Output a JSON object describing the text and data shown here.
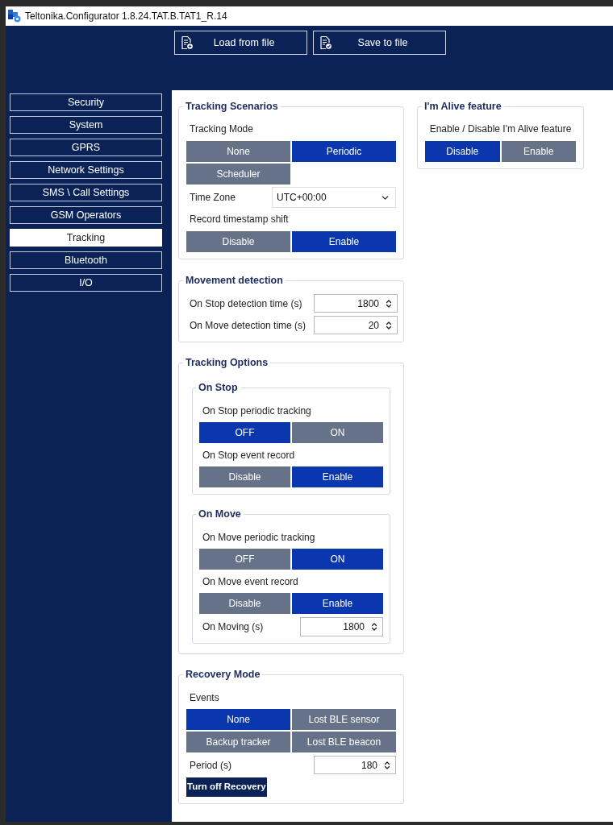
{
  "window": {
    "title": "Teltonika.Configurator 1.8.24.TAT.B.TAT1_R.14"
  },
  "toolbar": {
    "buttons": [
      {
        "kind": "load",
        "label": "Load from file"
      },
      {
        "kind": "save",
        "label": "Save to file"
      }
    ]
  },
  "sidebar": {
    "items": [
      {
        "label": "Security",
        "selected": false
      },
      {
        "label": "System",
        "selected": false
      },
      {
        "label": "GPRS",
        "selected": false
      },
      {
        "label": "Network Settings",
        "selected": false
      },
      {
        "label": "SMS \\ Call Settings",
        "selected": false
      },
      {
        "label": "GSM Operators",
        "selected": false
      },
      {
        "label": "Tracking",
        "selected": true
      },
      {
        "label": "Bluetooth",
        "selected": false
      },
      {
        "label": "I/O",
        "selected": false
      }
    ]
  },
  "tracking_scenarios": {
    "title": "Tracking Scenarios",
    "tracking_mode": {
      "label": "Tracking Mode",
      "options": [
        {
          "label": "None",
          "selected": false
        },
        {
          "label": "Periodic",
          "selected": true
        },
        {
          "label": "Scheduler",
          "selected": false
        }
      ]
    },
    "time_zone": {
      "label": "Time Zone",
      "value": "UTC+00:00"
    },
    "record_timestamp_shift": {
      "label": "Record timestamp shift",
      "options": [
        {
          "label": "Disable",
          "selected": false
        },
        {
          "label": "Enable",
          "selected": true
        }
      ]
    }
  },
  "im_alive": {
    "title": "I'm Alive feature",
    "label": "Enable / Disable I'm Alive feature",
    "options": [
      {
        "label": "Disable",
        "selected": true
      },
      {
        "label": "Enable",
        "selected": false
      }
    ]
  },
  "movement_detection": {
    "title": "Movement detection",
    "fields": [
      {
        "label": "On Stop detection time (s)",
        "value": "1800"
      },
      {
        "label": "On Move detection time (s)",
        "value": "20"
      }
    ]
  },
  "tracking_options": {
    "title": "Tracking Options",
    "groups": [
      {
        "title": "On Stop",
        "settings": [
          {
            "label": "On Stop periodic tracking",
            "options": [
              {
                "label": "OFF",
                "selected": true
              },
              {
                "label": "ON",
                "selected": false
              }
            ]
          },
          {
            "label": "On Stop event record",
            "options": [
              {
                "label": "Disable",
                "selected": false
              },
              {
                "label": "Enable",
                "selected": true
              }
            ]
          }
        ]
      },
      {
        "title": "On Move",
        "settings": [
          {
            "label": "On Move periodic tracking",
            "options": [
              {
                "label": "OFF",
                "selected": false
              },
              {
                "label": "ON",
                "selected": true
              }
            ]
          },
          {
            "label": "On Move event record",
            "options": [
              {
                "label": "Disable",
                "selected": false
              },
              {
                "label": "Enable",
                "selected": true
              }
            ]
          }
        ],
        "fields": [
          {
            "label": "On Moving (s)",
            "value": "1800"
          }
        ]
      }
    ]
  },
  "recovery_mode": {
    "title": "Recovery Mode",
    "events": {
      "label": "Events",
      "options": [
        {
          "label": "None",
          "selected": true
        },
        {
          "label": "Lost BLE sensor",
          "selected": false
        },
        {
          "label": "Backup tracker",
          "selected": false
        },
        {
          "label": "Lost BLE beacon",
          "selected": false
        }
      ]
    },
    "period": {
      "label": "Period (s)",
      "value": "180"
    },
    "action_button": "Turn off Recovery"
  }
}
